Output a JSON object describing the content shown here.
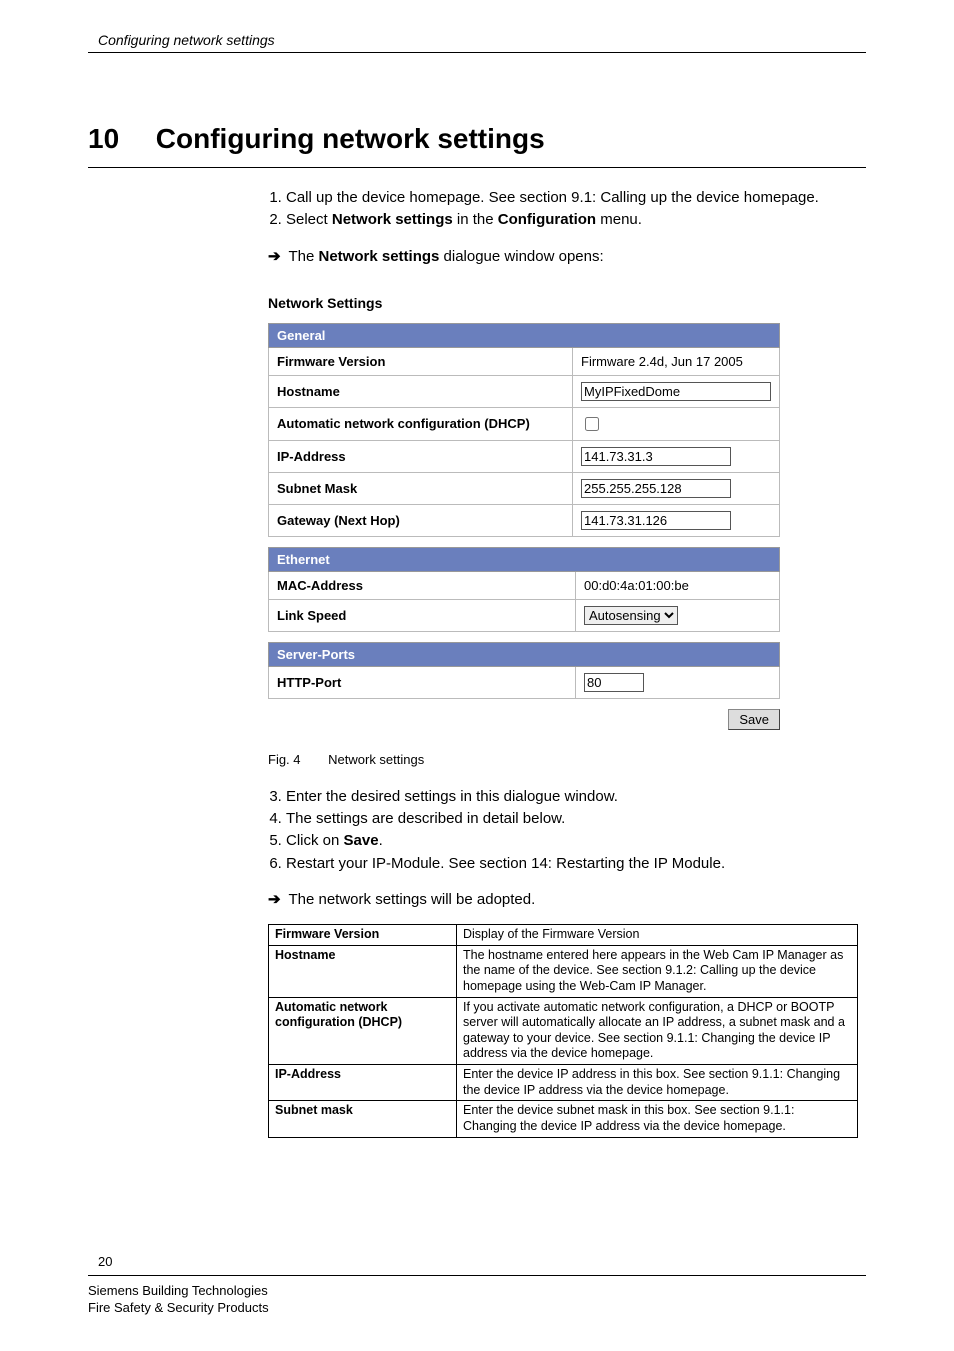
{
  "header": {
    "running": "Configuring network settings"
  },
  "chapter": {
    "number": "10",
    "title": "Configuring network settings"
  },
  "steps_a": {
    "s1_a": "Call up the device homepage. See section 9.1: Calling up the device homepage.",
    "s2_a": "Select ",
    "s2_b": "Network settings",
    "s2_c": " in the ",
    "s2_d": "Configuration",
    "s2_e": " menu.",
    "arrow_a": "The ",
    "arrow_b": "Network settings",
    "arrow_c": " dialogue window opens:"
  },
  "panel": {
    "title": "Network Settings",
    "general": {
      "heading": "General",
      "firmware_label": "Firmware Version",
      "firmware_value": "Firmware 2.4d, Jun 17 2005",
      "hostname_label": "Hostname",
      "hostname_value": "MyIPFixedDome",
      "dhcp_label": "Automatic network configuration (DHCP)",
      "ip_label": "IP-Address",
      "ip_value": "141.73.31.3",
      "subnet_label": "Subnet Mask",
      "subnet_value": "255.255.255.128",
      "gateway_label": "Gateway (Next Hop)",
      "gateway_value": "141.73.31.126"
    },
    "ethernet": {
      "heading": "Ethernet",
      "mac_label": "MAC-Address",
      "mac_value": "00:d0:4a:01:00:be",
      "link_label": "Link Speed",
      "link_value": "Autosensing"
    },
    "server": {
      "heading": "Server-Ports",
      "http_label": "HTTP-Port",
      "http_value": "80"
    },
    "save": "Save"
  },
  "figcap": {
    "num": "Fig. 4",
    "text": "Network settings"
  },
  "steps_b": {
    "s3": "Enter the desired settings in this dialogue window.",
    "s4": "The settings are described in detail below.",
    "s5_a": "Click on ",
    "s5_b": "Save",
    "s5_c": ".",
    "s6": "Restart your IP-Module. See section 14: Restarting the IP Module.",
    "arrow": "The network settings will be adopted."
  },
  "desc": {
    "r1k": "Firmware Version",
    "r1v": "Display of the Firmware Version",
    "r2k": "Hostname",
    "r2v": " The hostname entered here appears in the Web Cam IP Manager as the name of the device. See section 9.1.2: Calling up the device homepage using the Web-Cam IP Manager.",
    "r3k": "Automatic network configuration (DHCP)",
    "r3v": "If you activate automatic network configuration, a DHCP or BOOTP server will automatically allocate an IP address, a subnet mask and a gateway to your device. See section 9.1.1: Changing the device IP address via the device homepage.",
    "r4k": "IP-Address",
    "r4v": "Enter the device IP address in this box. See section 9.1.1: Changing the device IP address via the device homepage.",
    "r5k": "Subnet mask",
    "r5v": "Enter the device subnet mask in this box. See section 9.1.1: Changing the device IP address via the device homepage."
  },
  "footer": {
    "page": "20",
    "l1": "Siemens Building Technologies",
    "l2": "Fire Safety & Security Products"
  }
}
